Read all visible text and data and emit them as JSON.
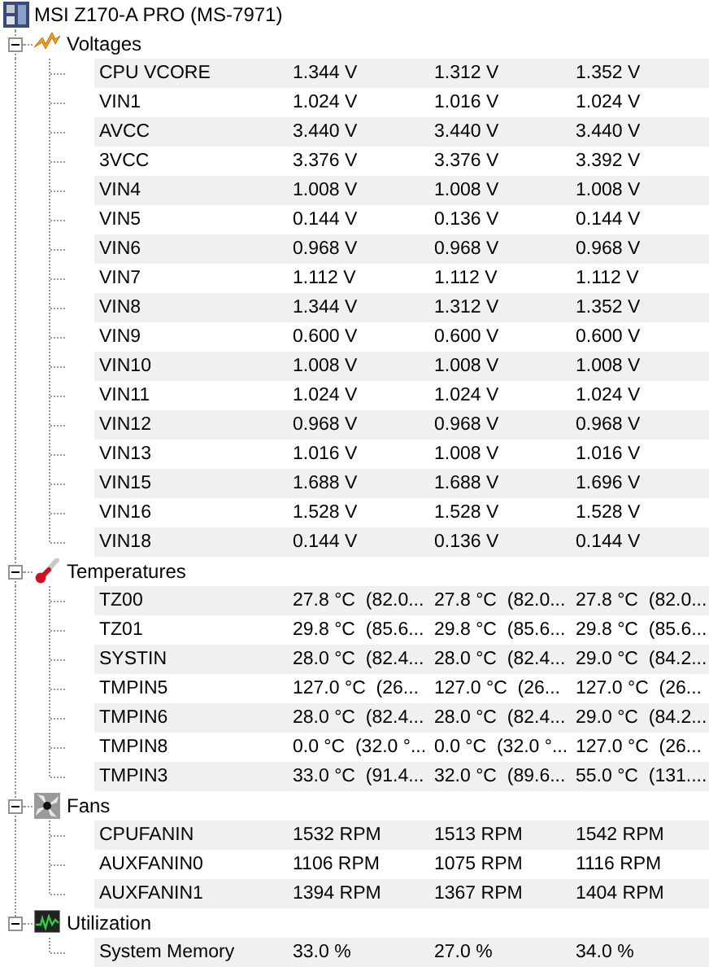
{
  "root": {
    "title": "MSI Z170-A PRO (MS-7971)"
  },
  "groups": [
    {
      "kind": "voltage",
      "label": "Voltages",
      "expanded": true,
      "items": [
        {
          "name": "CPU VCORE",
          "values": [
            "1.344 V",
            "1.312 V",
            "1.352 V"
          ]
        },
        {
          "name": "VIN1",
          "values": [
            "1.024 V",
            "1.016 V",
            "1.024 V"
          ]
        },
        {
          "name": "AVCC",
          "values": [
            "3.440 V",
            "3.440 V",
            "3.440 V"
          ]
        },
        {
          "name": "3VCC",
          "values": [
            "3.376 V",
            "3.376 V",
            "3.392 V"
          ]
        },
        {
          "name": "VIN4",
          "values": [
            "1.008 V",
            "1.008 V",
            "1.008 V"
          ]
        },
        {
          "name": "VIN5",
          "values": [
            "0.144 V",
            "0.136 V",
            "0.144 V"
          ]
        },
        {
          "name": "VIN6",
          "values": [
            "0.968 V",
            "0.968 V",
            "0.968 V"
          ]
        },
        {
          "name": "VIN7",
          "values": [
            "1.112 V",
            "1.112 V",
            "1.112 V"
          ]
        },
        {
          "name": "VIN8",
          "values": [
            "1.344 V",
            "1.312 V",
            "1.352 V"
          ]
        },
        {
          "name": "VIN9",
          "values": [
            "0.600 V",
            "0.600 V",
            "0.600 V"
          ]
        },
        {
          "name": "VIN10",
          "values": [
            "1.008 V",
            "1.008 V",
            "1.008 V"
          ]
        },
        {
          "name": "VIN11",
          "values": [
            "1.024 V",
            "1.024 V",
            "1.024 V"
          ]
        },
        {
          "name": "VIN12",
          "values": [
            "0.968 V",
            "0.968 V",
            "0.968 V"
          ]
        },
        {
          "name": "VIN13",
          "values": [
            "1.016 V",
            "1.008 V",
            "1.016 V"
          ]
        },
        {
          "name": "VIN15",
          "values": [
            "1.688 V",
            "1.688 V",
            "1.696 V"
          ]
        },
        {
          "name": "VIN16",
          "values": [
            "1.528 V",
            "1.528 V",
            "1.528 V"
          ]
        },
        {
          "name": "VIN18",
          "values": [
            "0.144 V",
            "0.136 V",
            "0.144 V"
          ]
        }
      ]
    },
    {
      "kind": "temperature",
      "label": "Temperatures",
      "expanded": true,
      "items": [
        {
          "name": "TZ00",
          "values": [
            "27.8 °C  (82.0...",
            "27.8 °C  (82.0...",
            "27.8 °C  (82.0..."
          ]
        },
        {
          "name": "TZ01",
          "values": [
            "29.8 °C  (85.6...",
            "29.8 °C  (85.6...",
            "29.8 °C  (85.6..."
          ]
        },
        {
          "name": "SYSTIN",
          "values": [
            "28.0 °C  (82.4...",
            "28.0 °C  (82.4...",
            "29.0 °C  (84.2..."
          ]
        },
        {
          "name": "TMPIN5",
          "values": [
            "127.0 °C  (26...",
            "127.0 °C  (26...",
            "127.0 °C  (26..."
          ]
        },
        {
          "name": "TMPIN6",
          "values": [
            "28.0 °C  (82.4...",
            "28.0 °C  (82.4...",
            "29.0 °C  (84.2..."
          ]
        },
        {
          "name": "TMPIN8",
          "values": [
            "0.0 °C  (32.0 °...",
            "0.0 °C  (32.0 °...",
            "127.0 °C  (26..."
          ]
        },
        {
          "name": "TMPIN3",
          "values": [
            "33.0 °C  (91.4...",
            "32.0 °C  (89.6...",
            "55.0 °C  (131...."
          ]
        }
      ]
    },
    {
      "kind": "fan",
      "label": "Fans",
      "expanded": true,
      "items": [
        {
          "name": "CPUFANIN",
          "values": [
            "1532 RPM",
            "1513 RPM",
            "1542 RPM"
          ]
        },
        {
          "name": "AUXFANIN0",
          "values": [
            "1106 RPM",
            "1075 RPM",
            "1116 RPM"
          ]
        },
        {
          "name": "AUXFANIN1",
          "values": [
            "1394 RPM",
            "1367 RPM",
            "1404 RPM"
          ]
        }
      ]
    },
    {
      "kind": "utilization",
      "label": "Utilization",
      "expanded": true,
      "items": [
        {
          "name": "System Memory",
          "values": [
            "33.0 %",
            "27.0 %",
            "34.0 %"
          ]
        }
      ]
    }
  ]
}
